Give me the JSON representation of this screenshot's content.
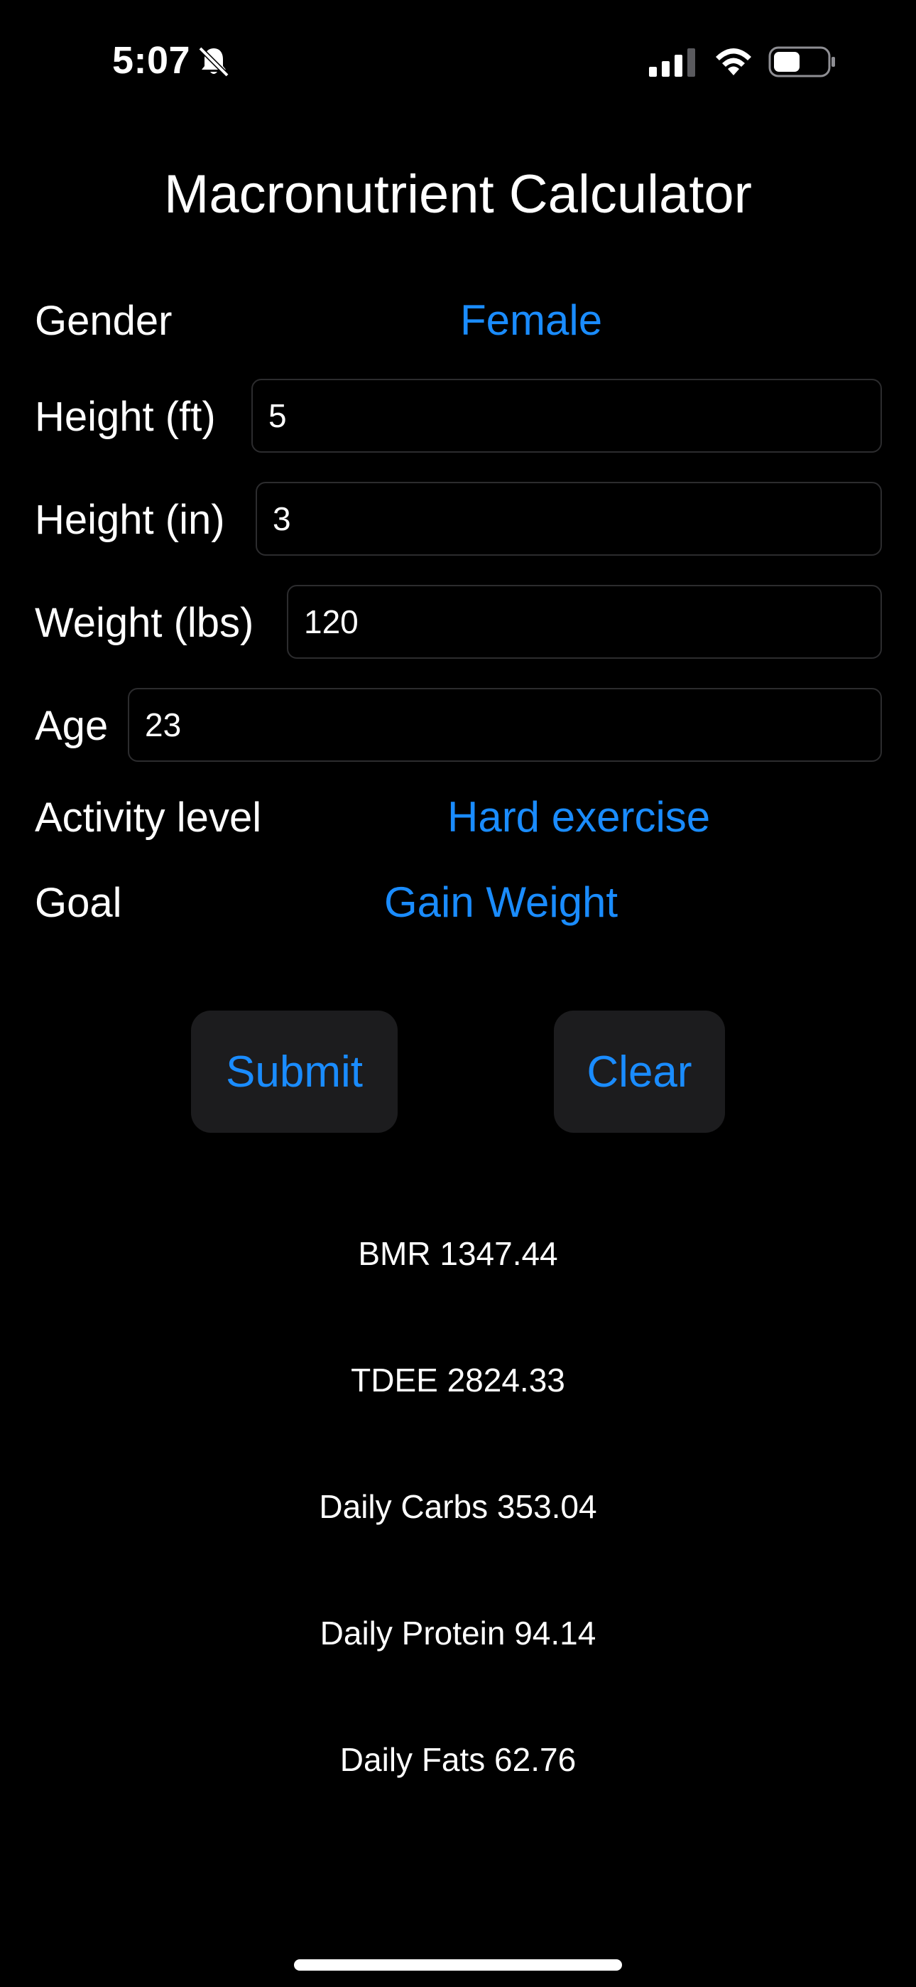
{
  "status_bar": {
    "time": "5:07",
    "icons": [
      "bell-slash-icon",
      "cellular-signal-icon",
      "wifi-icon",
      "battery-icon"
    ]
  },
  "title": "Macronutrient Calculator",
  "form": {
    "gender": {
      "label": "Gender",
      "value": "Female"
    },
    "height_ft": {
      "label": "Height (ft)",
      "value": "5"
    },
    "height_in": {
      "label": "Height (in)",
      "value": "3"
    },
    "weight": {
      "label": "Weight (lbs)",
      "value": "120"
    },
    "age": {
      "label": "Age",
      "value": "23"
    },
    "activity": {
      "label": "Activity level",
      "value": "Hard exercise"
    },
    "goal": {
      "label": "Goal",
      "value": "Gain Weight"
    }
  },
  "buttons": {
    "submit": "Submit",
    "clear": "Clear"
  },
  "results": {
    "bmr": "BMR 1347.44",
    "tdee": "TDEE 2824.33",
    "carbs": "Daily Carbs 353.04",
    "protein": "Daily Protein 94.14",
    "fats": "Daily Fats 62.76"
  },
  "colors": {
    "accent": "#1a8cff",
    "background": "#000000",
    "button_bg": "#1c1c1e"
  }
}
